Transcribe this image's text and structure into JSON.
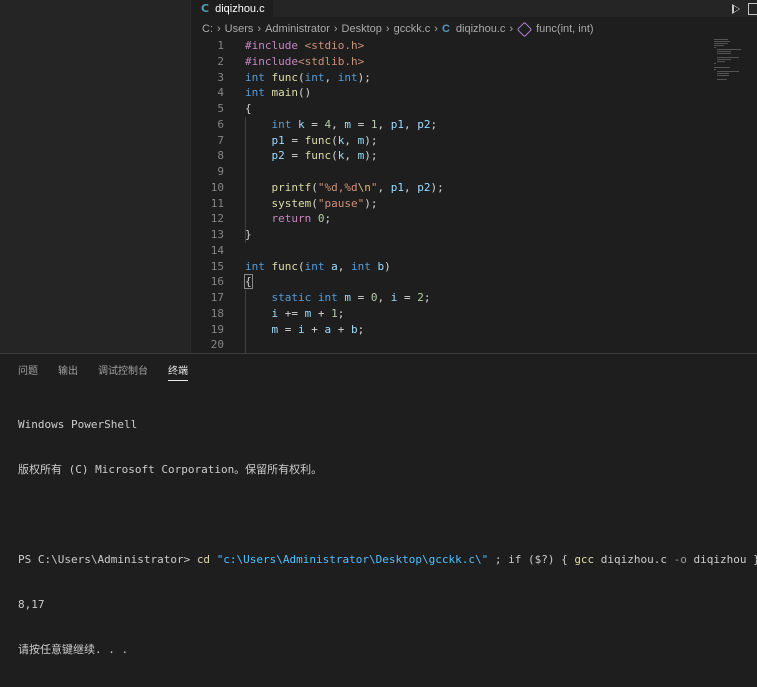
{
  "editor_tab": {
    "lang_icon": "C",
    "filename": "diqizhou.c"
  },
  "breadcrumb": {
    "parts": [
      "C:",
      "Users",
      "Administrator",
      "Desktop",
      "gcckk.c",
      "diqizhou.c",
      "func(int, int)"
    ],
    "file_icon": "C"
  },
  "code_lines": [
    {
      "n": "1",
      "tokens": [
        {
          "c": "ctl",
          "t": "#include "
        },
        {
          "c": "str",
          "t": "<stdio.h>"
        }
      ]
    },
    {
      "n": "2",
      "tokens": [
        {
          "c": "ctl",
          "t": "#include"
        },
        {
          "c": "str",
          "t": "<stdlib.h>"
        }
      ]
    },
    {
      "n": "3",
      "tokens": [
        {
          "c": "kw",
          "t": "int "
        },
        {
          "c": "fn",
          "t": "func"
        },
        {
          "c": "pun",
          "t": "("
        },
        {
          "c": "kw",
          "t": "int"
        },
        {
          "c": "pun",
          "t": ", "
        },
        {
          "c": "kw",
          "t": "int"
        },
        {
          "c": "pun",
          "t": ");"
        }
      ]
    },
    {
      "n": "4",
      "tokens": [
        {
          "c": "kw",
          "t": "int "
        },
        {
          "c": "fn",
          "t": "main"
        },
        {
          "c": "pun",
          "t": "()"
        }
      ]
    },
    {
      "n": "5",
      "tokens": [
        {
          "c": "pun",
          "t": "{"
        }
      ]
    },
    {
      "n": "6",
      "tokens": [
        {
          "c": "pun",
          "t": "    "
        },
        {
          "c": "kw",
          "t": "int "
        },
        {
          "c": "var",
          "t": "k"
        },
        {
          "c": "pun",
          "t": " = "
        },
        {
          "c": "num",
          "t": "4"
        },
        {
          "c": "pun",
          "t": ", "
        },
        {
          "c": "var",
          "t": "m"
        },
        {
          "c": "pun",
          "t": " = "
        },
        {
          "c": "num",
          "t": "1"
        },
        {
          "c": "pun",
          "t": ", "
        },
        {
          "c": "var",
          "t": "p1"
        },
        {
          "c": "pun",
          "t": ", "
        },
        {
          "c": "var",
          "t": "p2"
        },
        {
          "c": "pun",
          "t": ";"
        }
      ]
    },
    {
      "n": "7",
      "tokens": [
        {
          "c": "pun",
          "t": "    "
        },
        {
          "c": "var",
          "t": "p1"
        },
        {
          "c": "pun",
          "t": " = "
        },
        {
          "c": "fn",
          "t": "func"
        },
        {
          "c": "pun",
          "t": "("
        },
        {
          "c": "var",
          "t": "k"
        },
        {
          "c": "pun",
          "t": ", "
        },
        {
          "c": "var",
          "t": "m"
        },
        {
          "c": "pun",
          "t": ");"
        }
      ]
    },
    {
      "n": "8",
      "tokens": [
        {
          "c": "pun",
          "t": "    "
        },
        {
          "c": "var",
          "t": "p2"
        },
        {
          "c": "pun",
          "t": " = "
        },
        {
          "c": "fn",
          "t": "func"
        },
        {
          "c": "pun",
          "t": "("
        },
        {
          "c": "var",
          "t": "k"
        },
        {
          "c": "pun",
          "t": ", "
        },
        {
          "c": "var",
          "t": "m"
        },
        {
          "c": "pun",
          "t": ");"
        }
      ]
    },
    {
      "n": "9",
      "tokens": []
    },
    {
      "n": "10",
      "tokens": [
        {
          "c": "pun",
          "t": "    "
        },
        {
          "c": "fn",
          "t": "printf"
        },
        {
          "c": "pun",
          "t": "("
        },
        {
          "c": "str",
          "t": "\"%d,%d"
        },
        {
          "c": "esc",
          "t": "\\n"
        },
        {
          "c": "str",
          "t": "\""
        },
        {
          "c": "pun",
          "t": ", "
        },
        {
          "c": "var",
          "t": "p1"
        },
        {
          "c": "pun",
          "t": ", "
        },
        {
          "c": "var",
          "t": "p2"
        },
        {
          "c": "pun",
          "t": ");"
        }
      ]
    },
    {
      "n": "11",
      "tokens": [
        {
          "c": "pun",
          "t": "    "
        },
        {
          "c": "fn",
          "t": "system"
        },
        {
          "c": "pun",
          "t": "("
        },
        {
          "c": "str",
          "t": "\"pause\""
        },
        {
          "c": "pun",
          "t": ");"
        }
      ]
    },
    {
      "n": "12",
      "tokens": [
        {
          "c": "pun",
          "t": "    "
        },
        {
          "c": "ctl",
          "t": "return "
        },
        {
          "c": "num",
          "t": "0"
        },
        {
          "c": "pun",
          "t": ";"
        }
      ]
    },
    {
      "n": "13",
      "tokens": [
        {
          "c": "pun",
          "t": "}"
        }
      ]
    },
    {
      "n": "14",
      "tokens": []
    },
    {
      "n": "15",
      "tokens": [
        {
          "c": "kw",
          "t": "int "
        },
        {
          "c": "fn",
          "t": "func"
        },
        {
          "c": "pun",
          "t": "("
        },
        {
          "c": "kw",
          "t": "int "
        },
        {
          "c": "var",
          "t": "a"
        },
        {
          "c": "pun",
          "t": ", "
        },
        {
          "c": "kw",
          "t": "int "
        },
        {
          "c": "var",
          "t": "b"
        },
        {
          "c": "pun",
          "t": ")"
        }
      ]
    },
    {
      "n": "16",
      "tokens": [
        {
          "c": "pun",
          "t": "{"
        }
      ]
    },
    {
      "n": "17",
      "tokens": [
        {
          "c": "pun",
          "t": "    "
        },
        {
          "c": "kw",
          "t": "static int "
        },
        {
          "c": "var",
          "t": "m"
        },
        {
          "c": "pun",
          "t": " = "
        },
        {
          "c": "num",
          "t": "0"
        },
        {
          "c": "pun",
          "t": ", "
        },
        {
          "c": "var",
          "t": "i"
        },
        {
          "c": "pun",
          "t": " = "
        },
        {
          "c": "num",
          "t": "2"
        },
        {
          "c": "pun",
          "t": ";"
        }
      ]
    },
    {
      "n": "18",
      "tokens": [
        {
          "c": "pun",
          "t": "    "
        },
        {
          "c": "var",
          "t": "i"
        },
        {
          "c": "pun",
          "t": " += "
        },
        {
          "c": "var",
          "t": "m"
        },
        {
          "c": "pun",
          "t": " + "
        },
        {
          "c": "num",
          "t": "1"
        },
        {
          "c": "pun",
          "t": ";"
        }
      ]
    },
    {
      "n": "19",
      "tokens": [
        {
          "c": "pun",
          "t": "    "
        },
        {
          "c": "var",
          "t": "m"
        },
        {
          "c": "pun",
          "t": " = "
        },
        {
          "c": "var",
          "t": "i"
        },
        {
          "c": "pun",
          "t": " + "
        },
        {
          "c": "var",
          "t": "a"
        },
        {
          "c": "pun",
          "t": " + "
        },
        {
          "c": "var",
          "t": "b"
        },
        {
          "c": "pun",
          "t": ";"
        }
      ]
    },
    {
      "n": "20",
      "tokens": []
    }
  ],
  "panel_tabs": [
    {
      "label": "问题",
      "active": false
    },
    {
      "label": "输出",
      "active": false
    },
    {
      "label": "调试控制台",
      "active": false
    },
    {
      "label": "终端",
      "active": true
    }
  ],
  "terminal": {
    "line1": "Windows PowerShell",
    "line2": "版权所有 (C) Microsoft Corporation。保留所有权利。",
    "prompt": "PS C:\\Users\\Administrator> ",
    "cmd_cd": "cd ",
    "cmd_path": "\"c:\\Users\\Administrator\\Desktop\\gcckk.c\\\"",
    "cmd_rest1": " ; if ($?) { ",
    "cmd_gcc": "gcc",
    "cmd_args": " diqizhou.c ",
    "cmd_flag": "-o",
    "cmd_args2": " diqizhou } ; if ($?) { .\\diqizhou }",
    "output": "8,17",
    "pause_msg": "请按任意键继续. . ."
  },
  "colors": {
    "c_icon": "#519aba",
    "function_icon": "#b180d7"
  }
}
